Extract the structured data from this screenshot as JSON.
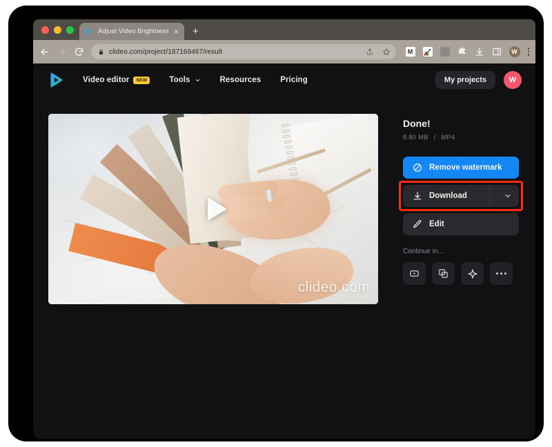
{
  "browser": {
    "tab": {
      "title": "Adjust Video Brightness, Contr",
      "favicon": "clideo-play-icon",
      "close_label": "×"
    },
    "new_tab_label": "+",
    "nav": {
      "back": "←",
      "forward": "→",
      "reload": "⟳"
    },
    "omnibox": {
      "url": "clideo.com/project/187169467/result",
      "lock_icon": "lock-icon",
      "share_icon": "share-icon",
      "bookmark_icon": "star-icon"
    },
    "extensions": [
      {
        "name": "gmail-extension-icon",
        "label": "M"
      },
      {
        "name": "checklist-extension-icon",
        "label": ""
      },
      {
        "name": "grey-extension-icon",
        "label": ""
      },
      {
        "name": "puzzle-extensions-icon",
        "label": ""
      }
    ],
    "downloads_icon": "download-icon",
    "sidepanel_icon": "side-panel-icon",
    "profile": {
      "name": "profile-avatar",
      "initial": "W"
    },
    "menu_icon": "three-dot-menu-icon"
  },
  "site": {
    "logo_name": "clideo-logo",
    "nav": [
      {
        "label": "Video editor",
        "badge": "NEW",
        "has_chevron": false
      },
      {
        "label": "Tools",
        "badge": "",
        "has_chevron": true
      },
      {
        "label": "Resources",
        "badge": "",
        "has_chevron": false
      },
      {
        "label": "Pricing",
        "badge": "",
        "has_chevron": false
      }
    ],
    "my_projects_label": "My projects",
    "avatar_initial": "W"
  },
  "video": {
    "play_button": "play-icon",
    "watermark": "clideo.com"
  },
  "result": {
    "title": "Done!",
    "size": "8.80 MB",
    "separator": "/",
    "format": "MP4",
    "remove_watermark_label": "Remove watermark",
    "remove_watermark_icon": "no-watermark-icon",
    "download_label": "Download",
    "download_icon": "download-icon",
    "download_chevron": "chevron-down-icon",
    "edit_label": "Edit",
    "edit_icon": "pencil-icon",
    "continue_label": "Continue in...",
    "continue_actions": [
      {
        "name": "video-player-icon"
      },
      {
        "name": "layers-copy-icon"
      },
      {
        "name": "compress-sparkle-icon"
      },
      {
        "name": "more-options-icon"
      }
    ]
  },
  "colors": {
    "accent_blue": "#1487f5",
    "highlight_red": "#ff2b11",
    "badge_yellow": "#ffc933",
    "avatar_pink": "#f8556b",
    "page_bg": "#111113"
  }
}
